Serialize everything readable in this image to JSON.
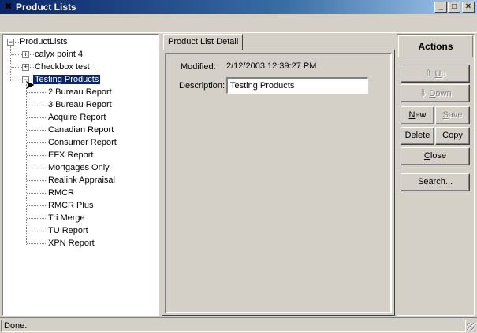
{
  "window": {
    "title": "Product Lists",
    "controls": {
      "minimize": "_",
      "maximize": "□",
      "close": "✕"
    }
  },
  "tree": {
    "root": "ProductLists",
    "nodes": [
      {
        "label": "calyx point 4",
        "expander": "+"
      },
      {
        "label": "Checkbox test",
        "expander": "+"
      },
      {
        "label": "Testing Products",
        "expander": "−",
        "selected": true,
        "children": [
          "2 Bureau Report",
          "3 Bureau Report",
          "Acquire Report",
          "Canadian Report",
          "Consumer Report",
          "EFX Report",
          "Mortgages Only",
          "Realink Appraisal",
          "RMCR",
          "RMCR Plus",
          "Tri Merge",
          "TU Report",
          "XPN Report"
        ]
      }
    ]
  },
  "detail": {
    "tab_label": "Product List Detail",
    "modified_label": "Modified:",
    "modified_value": "2/12/2003 12:39:27 PM",
    "description_label": "Description:",
    "description_value": "Testing Products"
  },
  "actions": {
    "header": "Actions",
    "up": {
      "label": "Up",
      "underline": "U",
      "rest": "p",
      "icon": "up-arrow-icon",
      "enabled": false
    },
    "down": {
      "label": "Down",
      "underline": "D",
      "rest": "own",
      "icon": "down-arrow-icon",
      "enabled": false
    },
    "new": {
      "label": "New",
      "underline": "N",
      "rest": "ew",
      "enabled": true
    },
    "save": {
      "label": "Save",
      "underline": "S",
      "rest": "ave",
      "enabled": false
    },
    "delete": {
      "label": "Delete",
      "underline": "D",
      "rest": "elete",
      "enabled": true
    },
    "copy": {
      "label": "Copy",
      "underline": "C",
      "rest": "opy",
      "enabled": true
    },
    "close": {
      "label": "Close",
      "underline": "C",
      "rest": "lose",
      "enabled": true
    },
    "search": {
      "label": "Search...",
      "underline": "",
      "rest": "Search...",
      "enabled": true
    }
  },
  "status": {
    "text": "Done."
  },
  "colors": {
    "title_gradient_start": "#0a246a",
    "title_gradient_end": "#a6caf0",
    "selection": "#0a246a",
    "face": "#d4d0c8"
  }
}
